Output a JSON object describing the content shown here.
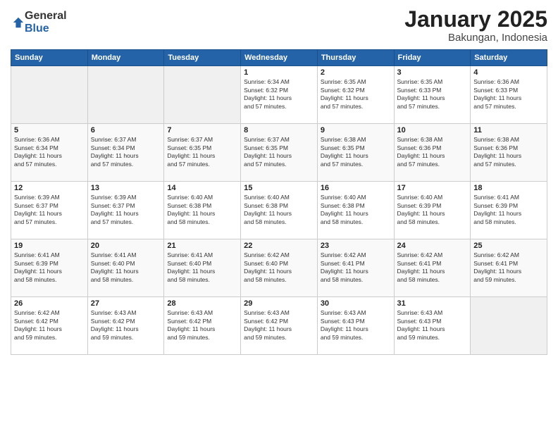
{
  "logo": {
    "general": "General",
    "blue": "Blue"
  },
  "title": "January 2025",
  "location": "Bakungan, Indonesia",
  "days_header": [
    "Sunday",
    "Monday",
    "Tuesday",
    "Wednesday",
    "Thursday",
    "Friday",
    "Saturday"
  ],
  "weeks": [
    [
      {
        "day": "",
        "info": ""
      },
      {
        "day": "",
        "info": ""
      },
      {
        "day": "",
        "info": ""
      },
      {
        "day": "1",
        "info": "Sunrise: 6:34 AM\nSunset: 6:32 PM\nDaylight: 11 hours\nand 57 minutes."
      },
      {
        "day": "2",
        "info": "Sunrise: 6:35 AM\nSunset: 6:32 PM\nDaylight: 11 hours\nand 57 minutes."
      },
      {
        "day": "3",
        "info": "Sunrise: 6:35 AM\nSunset: 6:33 PM\nDaylight: 11 hours\nand 57 minutes."
      },
      {
        "day": "4",
        "info": "Sunrise: 6:36 AM\nSunset: 6:33 PM\nDaylight: 11 hours\nand 57 minutes."
      }
    ],
    [
      {
        "day": "5",
        "info": "Sunrise: 6:36 AM\nSunset: 6:34 PM\nDaylight: 11 hours\nand 57 minutes."
      },
      {
        "day": "6",
        "info": "Sunrise: 6:37 AM\nSunset: 6:34 PM\nDaylight: 11 hours\nand 57 minutes."
      },
      {
        "day": "7",
        "info": "Sunrise: 6:37 AM\nSunset: 6:35 PM\nDaylight: 11 hours\nand 57 minutes."
      },
      {
        "day": "8",
        "info": "Sunrise: 6:37 AM\nSunset: 6:35 PM\nDaylight: 11 hours\nand 57 minutes."
      },
      {
        "day": "9",
        "info": "Sunrise: 6:38 AM\nSunset: 6:35 PM\nDaylight: 11 hours\nand 57 minutes."
      },
      {
        "day": "10",
        "info": "Sunrise: 6:38 AM\nSunset: 6:36 PM\nDaylight: 11 hours\nand 57 minutes."
      },
      {
        "day": "11",
        "info": "Sunrise: 6:38 AM\nSunset: 6:36 PM\nDaylight: 11 hours\nand 57 minutes."
      }
    ],
    [
      {
        "day": "12",
        "info": "Sunrise: 6:39 AM\nSunset: 6:37 PM\nDaylight: 11 hours\nand 57 minutes."
      },
      {
        "day": "13",
        "info": "Sunrise: 6:39 AM\nSunset: 6:37 PM\nDaylight: 11 hours\nand 57 minutes."
      },
      {
        "day": "14",
        "info": "Sunrise: 6:40 AM\nSunset: 6:38 PM\nDaylight: 11 hours\nand 58 minutes."
      },
      {
        "day": "15",
        "info": "Sunrise: 6:40 AM\nSunset: 6:38 PM\nDaylight: 11 hours\nand 58 minutes."
      },
      {
        "day": "16",
        "info": "Sunrise: 6:40 AM\nSunset: 6:38 PM\nDaylight: 11 hours\nand 58 minutes."
      },
      {
        "day": "17",
        "info": "Sunrise: 6:40 AM\nSunset: 6:39 PM\nDaylight: 11 hours\nand 58 minutes."
      },
      {
        "day": "18",
        "info": "Sunrise: 6:41 AM\nSunset: 6:39 PM\nDaylight: 11 hours\nand 58 minutes."
      }
    ],
    [
      {
        "day": "19",
        "info": "Sunrise: 6:41 AM\nSunset: 6:39 PM\nDaylight: 11 hours\nand 58 minutes."
      },
      {
        "day": "20",
        "info": "Sunrise: 6:41 AM\nSunset: 6:40 PM\nDaylight: 11 hours\nand 58 minutes."
      },
      {
        "day": "21",
        "info": "Sunrise: 6:41 AM\nSunset: 6:40 PM\nDaylight: 11 hours\nand 58 minutes."
      },
      {
        "day": "22",
        "info": "Sunrise: 6:42 AM\nSunset: 6:40 PM\nDaylight: 11 hours\nand 58 minutes."
      },
      {
        "day": "23",
        "info": "Sunrise: 6:42 AM\nSunset: 6:41 PM\nDaylight: 11 hours\nand 58 minutes."
      },
      {
        "day": "24",
        "info": "Sunrise: 6:42 AM\nSunset: 6:41 PM\nDaylight: 11 hours\nand 58 minutes."
      },
      {
        "day": "25",
        "info": "Sunrise: 6:42 AM\nSunset: 6:41 PM\nDaylight: 11 hours\nand 59 minutes."
      }
    ],
    [
      {
        "day": "26",
        "info": "Sunrise: 6:42 AM\nSunset: 6:42 PM\nDaylight: 11 hours\nand 59 minutes."
      },
      {
        "day": "27",
        "info": "Sunrise: 6:43 AM\nSunset: 6:42 PM\nDaylight: 11 hours\nand 59 minutes."
      },
      {
        "day": "28",
        "info": "Sunrise: 6:43 AM\nSunset: 6:42 PM\nDaylight: 11 hours\nand 59 minutes."
      },
      {
        "day": "29",
        "info": "Sunrise: 6:43 AM\nSunset: 6:42 PM\nDaylight: 11 hours\nand 59 minutes."
      },
      {
        "day": "30",
        "info": "Sunrise: 6:43 AM\nSunset: 6:43 PM\nDaylight: 11 hours\nand 59 minutes."
      },
      {
        "day": "31",
        "info": "Sunrise: 6:43 AM\nSunset: 6:43 PM\nDaylight: 11 hours\nand 59 minutes."
      },
      {
        "day": "",
        "info": ""
      }
    ]
  ]
}
